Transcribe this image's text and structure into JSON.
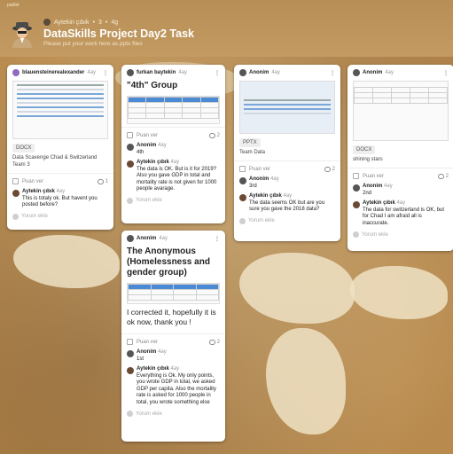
{
  "header": {
    "top_text": "padlet",
    "author": "Aytekin çıbık",
    "likes": "3",
    "age": "4g",
    "title": "DataSkills Project Day2 Task",
    "subtitle": "Please put your work here as pptx files"
  },
  "cards": [
    {
      "author": "blauensteinerealexander",
      "time": "4ay",
      "file_tag": "DOCX",
      "file_name": "Data Scavenge Chad & Switzerland Team 3",
      "rate": "Puan ver",
      "comment_count": "1",
      "comments": [
        {
          "name": "Aytekin çıbık",
          "time": "4ay",
          "text": "This is totaly ok. But havent you posted before?"
        }
      ],
      "add_comment": "Yorum ekle"
    },
    {
      "author": "furkan baytekin",
      "time": "4ay",
      "title": "\"4th\" Group",
      "rate": "Puan ver",
      "comment_count": "2",
      "comments": [
        {
          "name": "Anonim",
          "time": "4ay",
          "text": "4th"
        },
        {
          "name": "Aytekin çıbık",
          "time": "4ay",
          "text": "The data is OK. But is it for 2019? Also you gave GDP in total and mortality rate is not given for 1000 people avarage."
        }
      ],
      "add_comment": "Yorum ekle"
    },
    {
      "author": "Anonim",
      "time": "4ay",
      "title": "The Anonymous (Homelessness and gender group)",
      "body": "I corrected it, hopefully it is ok now, thank you !",
      "rate": "Puan ver",
      "comment_count": "2",
      "comments": [
        {
          "name": "Anonim",
          "time": "4ay",
          "text": "1st"
        },
        {
          "name": "Aytekin çıbık",
          "time": "4ay",
          "text": "Everything is Ok. My only points, you wrote GDP in total, we asked GDP per capita. Also the mortality rate is asked for 1000 people in total, you wrote something else"
        }
      ],
      "add_comment": "Yorum ekle"
    },
    {
      "author": "Anonim",
      "time": "4ay",
      "file_tag": "PPTX",
      "file_name": "Team Data",
      "rate": "Puan ver",
      "comment_count": "2",
      "comments": [
        {
          "name": "Anonim",
          "time": "4ay",
          "text": "3rd"
        },
        {
          "name": "Aytekin çıbık",
          "time": "4ay",
          "text": "The data seems OK but are you sure you gave the 2018 data?"
        }
      ],
      "add_comment": "Yorum ekle"
    },
    {
      "author": "Anonim",
      "time": "4ay",
      "file_tag": "DOCX",
      "file_name": "shining stars",
      "rate": "Puan ver",
      "comment_count": "2",
      "comments": [
        {
          "name": "Anonim",
          "time": "4ay",
          "text": "2nd"
        },
        {
          "name": "Aytekin çıbık",
          "time": "4ay",
          "text": "The data for switzerland is OK, but for Chad I am afraid all is inaccurate."
        }
      ],
      "add_comment": "Yorum ekle"
    }
  ],
  "colors": {
    "accent_blue": "#4a8ad4",
    "avatar_purple": "#8e6bbf",
    "avatar_brown": "#6b4a35"
  }
}
